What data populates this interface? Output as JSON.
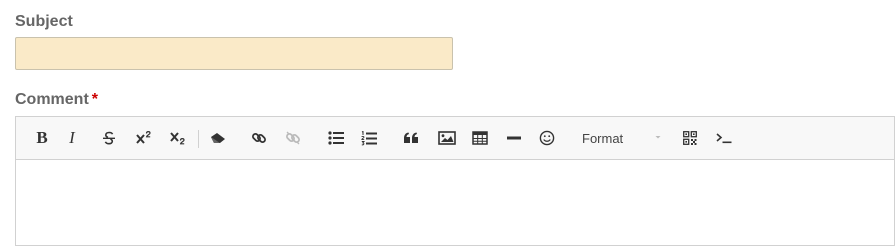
{
  "subject": {
    "label": "Subject",
    "value": "",
    "placeholder": ""
  },
  "comment": {
    "label": "Comment",
    "required_marker": "*",
    "content": ""
  },
  "toolbar": {
    "bold": "B",
    "italic": "I",
    "format_label": "Format",
    "buttons": [
      "bold-icon",
      "italic-icon",
      "strikethrough-icon",
      "superscript-icon",
      "subscript-icon",
      "eraser-icon",
      "link-icon",
      "unlink-icon",
      "bulleted-list-icon",
      "numbered-list-icon",
      "blockquote-icon",
      "image-icon",
      "table-icon",
      "horizontal-rule-icon",
      "smiley-icon",
      "format-dropdown",
      "qr-code-icon",
      "terminal-icon"
    ]
  },
  "colors": {
    "subject_bg": "#faeac8",
    "label_text": "#666666",
    "required": "#cc0000",
    "toolbar_bg": "#f8f8f8"
  }
}
